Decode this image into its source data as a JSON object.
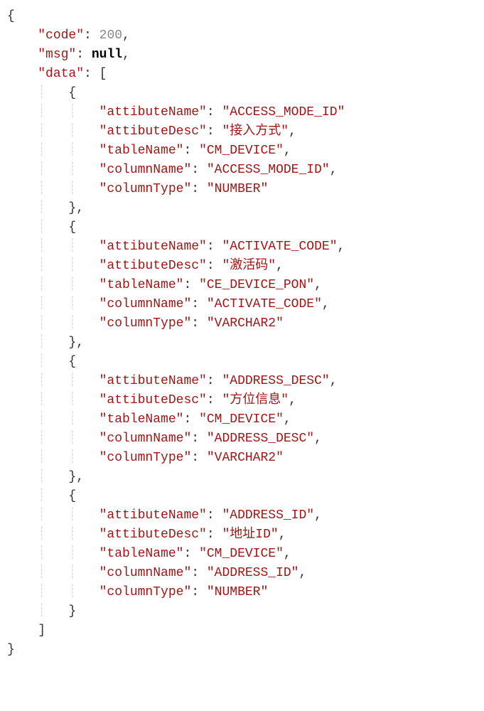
{
  "json": {
    "code_key": "\"code\"",
    "code_val": "200",
    "msg_key": "\"msg\"",
    "msg_val": "null",
    "data_key": "\"data\"",
    "items": [
      {
        "attibuteName_key": "\"attibuteName\"",
        "attibuteName_val": "\"ACCESS_MODE_ID\"",
        "attibuteDesc_key": "\"attibuteDesc\"",
        "attibuteDesc_val": "\"接入方式\"",
        "tableName_key": "\"tableName\"",
        "tableName_val": "\"CM_DEVICE\"",
        "columnName_key": "\"columnName\"",
        "columnName_val": "\"ACCESS_MODE_ID\"",
        "columnType_key": "\"columnType\"",
        "columnType_val": "\"NUMBER\""
      },
      {
        "attibuteName_key": "\"attibuteName\"",
        "attibuteName_val": "\"ACTIVATE_CODE\"",
        "attibuteDesc_key": "\"attibuteDesc\"",
        "attibuteDesc_val": "\"激活码\"",
        "tableName_key": "\"tableName\"",
        "tableName_val": "\"CE_DEVICE_PON\"",
        "columnName_key": "\"columnName\"",
        "columnName_val": "\"ACTIVATE_CODE\"",
        "columnType_key": "\"columnType\"",
        "columnType_val": "\"VARCHAR2\""
      },
      {
        "attibuteName_key": "\"attibuteName\"",
        "attibuteName_val": "\"ADDRESS_DESC\"",
        "attibuteDesc_key": "\"attibuteDesc\"",
        "attibuteDesc_val": "\"方位信息\"",
        "tableName_key": "\"tableName\"",
        "tableName_val": "\"CM_DEVICE\"",
        "columnName_key": "\"columnName\"",
        "columnName_val": "\"ADDRESS_DESC\"",
        "columnType_key": "\"columnType\"",
        "columnType_val": "\"VARCHAR2\""
      },
      {
        "attibuteName_key": "\"attibuteName\"",
        "attibuteName_val": "\"ADDRESS_ID\"",
        "attibuteDesc_key": "\"attibuteDesc\"",
        "attibuteDesc_val": "\"地址ID\"",
        "tableName_key": "\"tableName\"",
        "tableName_val": "\"CM_DEVICE\"",
        "columnName_key": "\"columnName\"",
        "columnName_val": "\"ADDRESS_ID\"",
        "columnType_key": "\"columnType\"",
        "columnType_val": "\"NUMBER\""
      }
    ]
  },
  "brace_open": "{",
  "brace_close": "}",
  "bracket_open": "[",
  "bracket_close": "]",
  "colon": ": ",
  "comma": ","
}
